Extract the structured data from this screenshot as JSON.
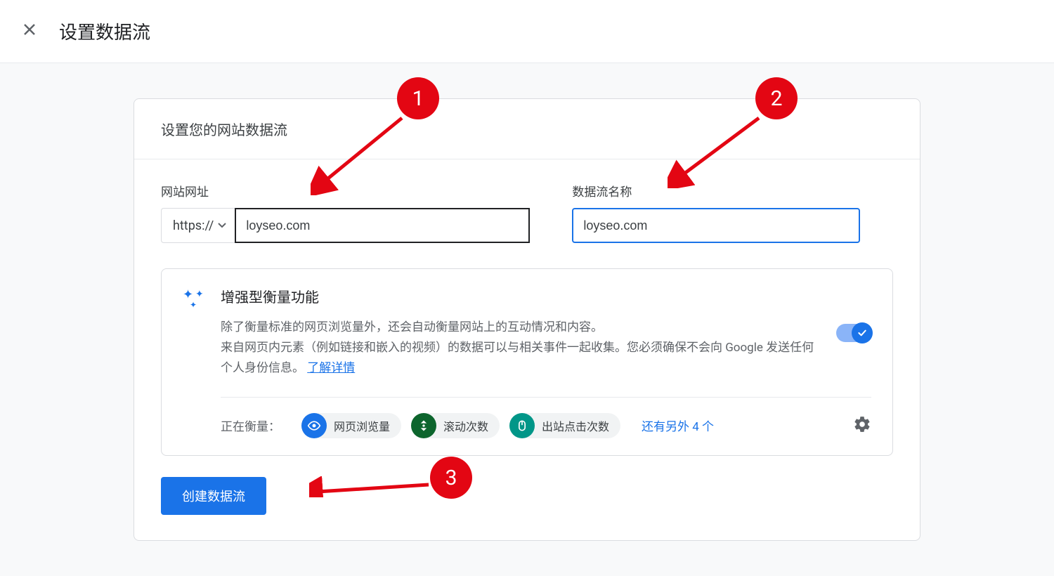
{
  "header": {
    "title": "设置数据流"
  },
  "card": {
    "section_title": "设置您的网站数据流",
    "url_label": "网站网址",
    "protocol": "https://",
    "url_value": "loyseo.com",
    "stream_name_label": "数据流名称",
    "stream_name_value": "loyseo.com"
  },
  "enhanced": {
    "title": "增强型衡量功能",
    "desc_line1": "除了衡量标准的网页浏览量外，还会自动衡量网站上的互动情况和内容。",
    "desc_line2": "来自网页内元素（例如链接和嵌入的视频）的数据可以与相关事件一起收集。您必须确保不会向 Google 发送任何个人身份信息。",
    "learn_more": "了解详情",
    "measuring_label": "正在衡量：",
    "chips": [
      {
        "label": "网页浏览量",
        "icon": "eye",
        "color": "blue"
      },
      {
        "label": "滚动次数",
        "icon": "scroll",
        "color": "green"
      },
      {
        "label": "出站点击次数",
        "icon": "click",
        "color": "teal"
      }
    ],
    "more_text": "还有另外 4 个",
    "toggle_on": true
  },
  "create_button": "创建数据流",
  "annotations": {
    "a1": "1",
    "a2": "2",
    "a3": "3"
  }
}
